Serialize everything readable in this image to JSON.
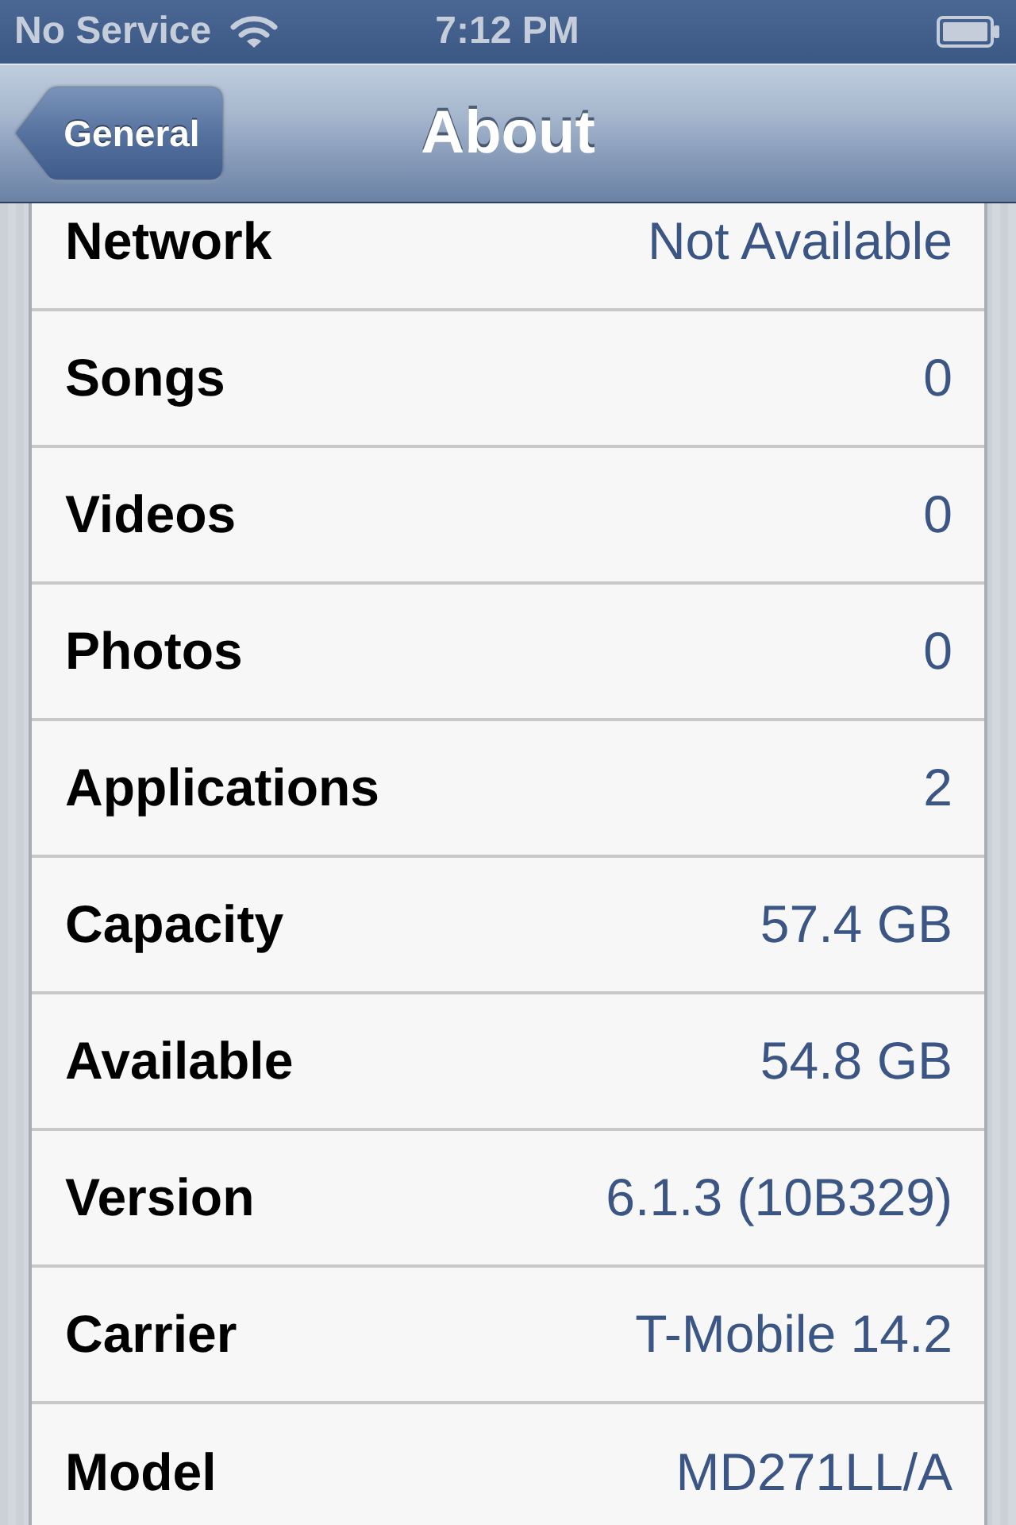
{
  "status_bar": {
    "carrier": "No Service",
    "time": "7:12 PM"
  },
  "nav_bar": {
    "back_button": "General",
    "title": "About"
  },
  "rows": [
    {
      "label": "Network",
      "value": "Not Available"
    },
    {
      "label": "Songs",
      "value": "0"
    },
    {
      "label": "Videos",
      "value": "0"
    },
    {
      "label": "Photos",
      "value": "0"
    },
    {
      "label": "Applications",
      "value": "2"
    },
    {
      "label": "Capacity",
      "value": "57.4 GB"
    },
    {
      "label": "Available",
      "value": "54.8 GB"
    },
    {
      "label": "Version",
      "value": "6.1.3 (10B329)"
    },
    {
      "label": "Carrier",
      "value": "T-Mobile 14.2"
    },
    {
      "label": "Model",
      "value": "MD271LL/A"
    }
  ]
}
